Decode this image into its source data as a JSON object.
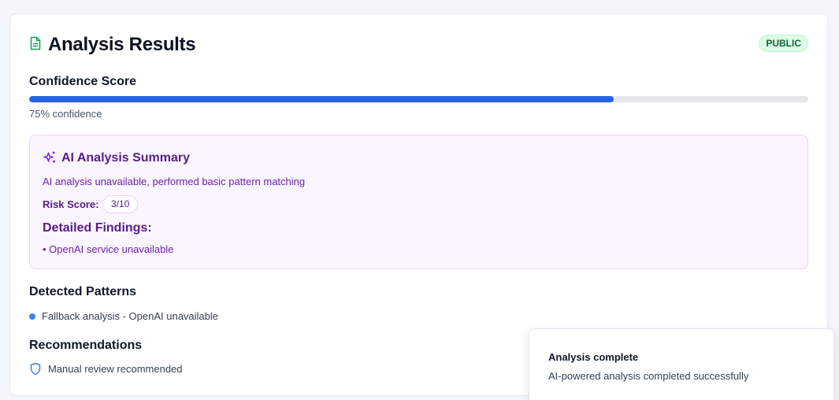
{
  "header": {
    "title": "Analysis Results",
    "visibility_badge": "PUBLIC",
    "icon": "document-icon"
  },
  "confidence": {
    "label": "Confidence Score",
    "value": 0.75,
    "text": "75% confidence"
  },
  "ai_summary": {
    "icon": "sparkles-icon",
    "title": "AI Analysis Summary",
    "description": "AI analysis unavailable, performed basic pattern matching",
    "risk_label": "Risk Score:",
    "risk_value": "3/10",
    "findings_title": "Detailed Findings:",
    "findings": [
      "• OpenAI service unavailable"
    ]
  },
  "patterns": {
    "title": "Detected Patterns",
    "items": [
      "Fallback analysis - OpenAI unavailable"
    ]
  },
  "recommendations": {
    "title": "Recommendations",
    "icon": "shield-icon",
    "items": [
      "Manual review recommended"
    ]
  },
  "toast": {
    "title": "Analysis complete",
    "description": "AI-powered analysis completed successfully"
  },
  "colors": {
    "accent": "#2563eb",
    "summary_bg": "#faf5ff",
    "summary_text": "#6b21a8",
    "badge_bg": "#dcfce7",
    "badge_text": "#166534"
  }
}
